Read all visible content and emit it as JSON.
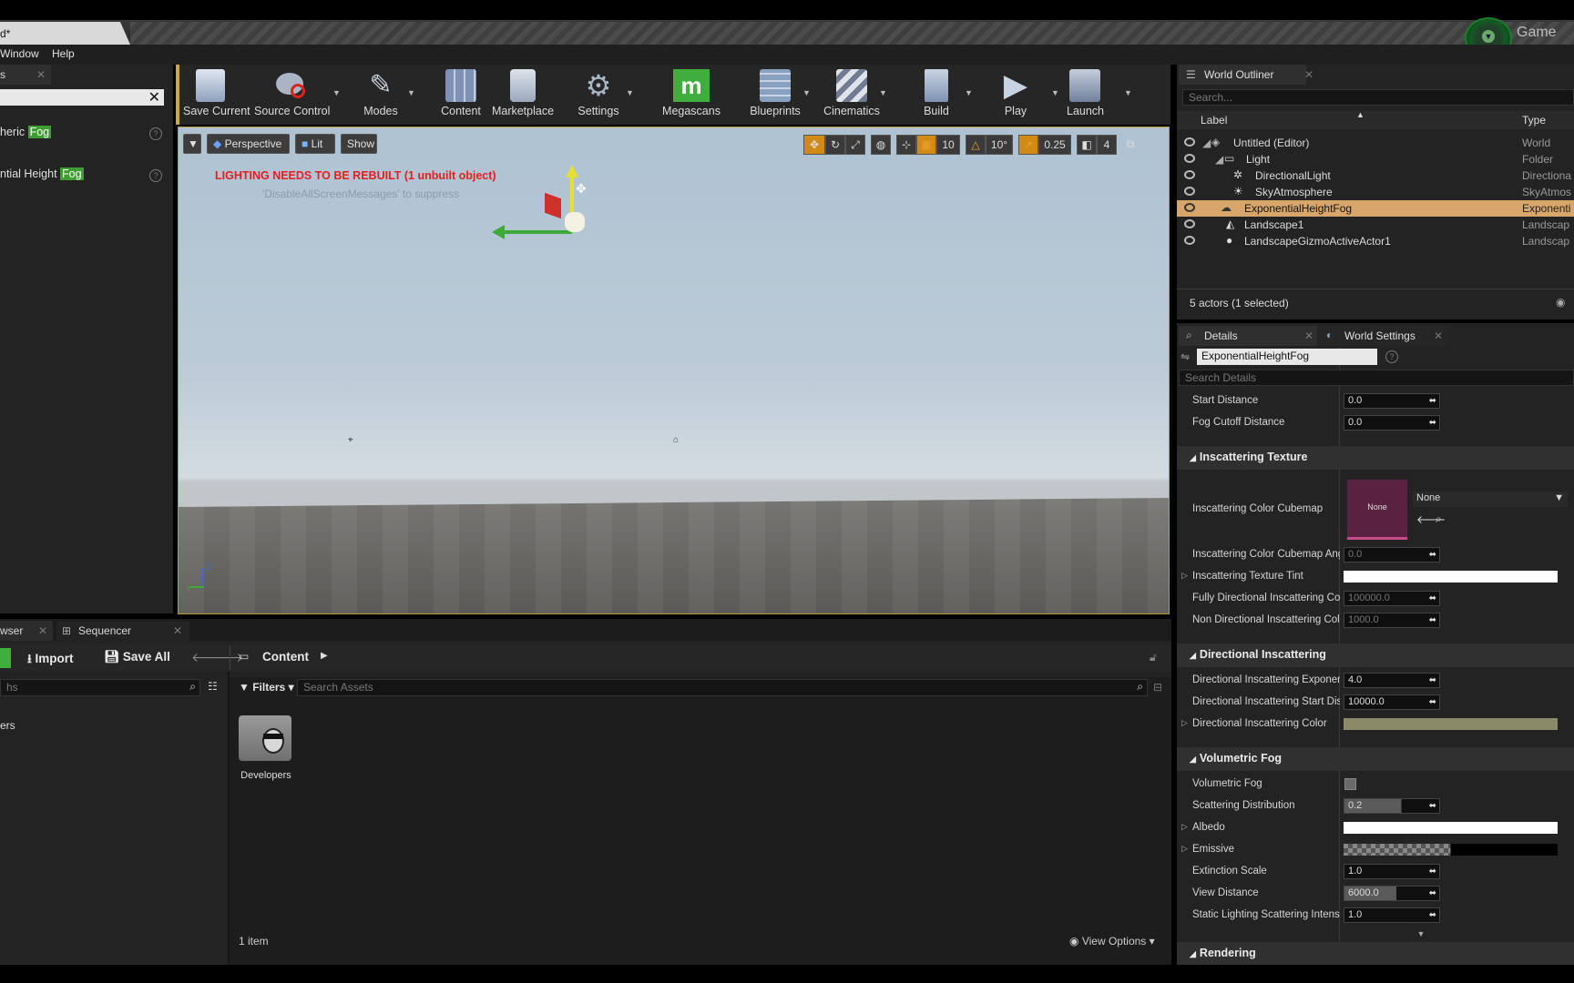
{
  "window": {
    "tab_title": "d*",
    "game_label": "Game"
  },
  "menu": [
    "Window",
    "Help"
  ],
  "left_panel": {
    "tab": "s",
    "results": [
      {
        "prefix": "heric ",
        "match": "Fog"
      },
      {
        "prefix": "ntial Height ",
        "match": "Fog"
      }
    ]
  },
  "toolbar": {
    "items": [
      "Save Current",
      "Source Control",
      "Modes",
      "Content",
      "Marketplace",
      "Settings",
      "Megascans",
      "Blueprints",
      "Cinematics",
      "Build",
      "Play",
      "Launch"
    ]
  },
  "viewport": {
    "view_mode": "Perspective",
    "lit": "Lit",
    "show": "Show",
    "grid_snap": "10",
    "rot_snap": "10°",
    "scale_snap": "0.25",
    "cam_speed": "4",
    "warning": "LIGHTING NEEDS TO BE REBUILT (1 unbuilt object)",
    "warning_hint": "'DisableAllScreenMessages' to suppress"
  },
  "outliner": {
    "tab": "World Outliner",
    "search_placeholder": "Search...",
    "col_label": "Label",
    "col_type": "Type",
    "rows": [
      {
        "label": "Untitled (Editor)",
        "type": "World"
      },
      {
        "label": "Light",
        "type": "Folder"
      },
      {
        "label": "DirectionalLight",
        "type": "Directiona"
      },
      {
        "label": "SkyAtmosphere",
        "type": "SkyAtmos"
      },
      {
        "label": "ExponentialHeightFog",
        "type": "Exponenti"
      },
      {
        "label": "Landscape1",
        "type": "Landscap"
      },
      {
        "label": "LandscapeGizmoActiveActor1",
        "type": "Landscap"
      }
    ],
    "status": "5 actors (1 selected)"
  },
  "details": {
    "tab": "Details",
    "tab2": "World Settings",
    "object_name": "ExponentialHeightFog",
    "search_placeholder": "Search Details",
    "start_distance": {
      "label": "Start Distance",
      "value": "0.0"
    },
    "fog_cutoff": {
      "label": "Fog Cutoff Distance",
      "value": "0.0"
    },
    "cat_inscattering_texture": "Inscattering Texture",
    "cubemap": {
      "label": "Inscattering Color Cubemap",
      "thumb": "None",
      "value": "None"
    },
    "cubemap_angle": {
      "label": "Inscattering Color Cubemap Angl",
      "value": "0.0"
    },
    "texture_tint": {
      "label": "Inscattering Texture Tint"
    },
    "fully_dir": {
      "label": "Fully Directional Inscattering Col",
      "value": "100000.0"
    },
    "non_dir": {
      "label": "Non Directional Inscattering Colc",
      "value": "1000.0"
    },
    "cat_directional": "Directional Inscattering",
    "dir_exp": {
      "label": "Directional Inscattering Exponen",
      "value": "4.0"
    },
    "dir_start": {
      "label": "Directional Inscattering Start Dis",
      "value": "10000.0"
    },
    "dir_color": {
      "label": "Directional Inscattering Color",
      "color": "#8a8a68"
    },
    "cat_volumetric": "Volumetric Fog",
    "vol_fog": {
      "label": "Volumetric Fog"
    },
    "scatter": {
      "label": "Scattering Distribution",
      "value": "0.2"
    },
    "albedo": {
      "label": "Albedo"
    },
    "emissive": {
      "label": "Emissive"
    },
    "extinction": {
      "label": "Extinction Scale",
      "value": "1.0"
    },
    "view_distance": {
      "label": "View Distance",
      "value": "6000.0"
    },
    "static_lighting": {
      "label": "Static Lighting Scattering Intens",
      "value": "1.0"
    },
    "cat_rendering": "Rendering"
  },
  "content_browser": {
    "tab1": "wser",
    "tab2": "Sequencer",
    "import": "Import",
    "save_all": "Save All",
    "path": "Content",
    "filters": "Filters",
    "search_placeholder": "Search Assets",
    "left_item": "ers",
    "left_search": "hs",
    "asset": "Developers",
    "count": "1 item",
    "view_options": "View Options"
  }
}
